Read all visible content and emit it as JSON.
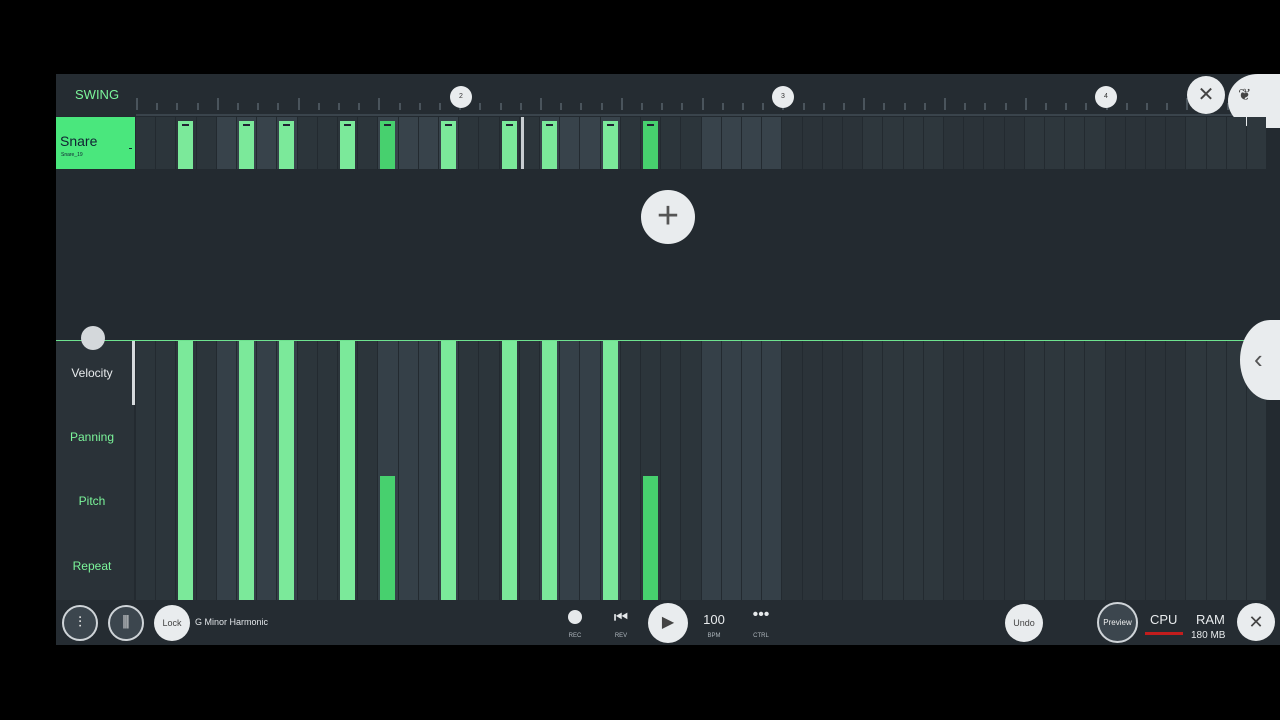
{
  "header": {
    "swing_label": "SWING",
    "bar_markers": [
      "2",
      "3",
      "4"
    ],
    "close_icon": "close-icon",
    "logo_icon": "fruit-logo-icon"
  },
  "channel": {
    "name": "Snare",
    "sample": "Snare_19",
    "steps_on": [
      2,
      5,
      7,
      10,
      12,
      15,
      18,
      20,
      23,
      25
    ],
    "steps_accent": [
      12,
      25
    ],
    "total_steps": 16
  },
  "add_button_icon": "plus-icon",
  "event_editor": {
    "labels": [
      "Velocity",
      "Panning",
      "Pitch",
      "Repeat"
    ],
    "active_label_color": "#e8ebed",
    "label_color": "#7bf59a",
    "velocity_values": [
      1.0,
      1.0,
      1.0,
      1.0,
      0.48,
      1.0,
      1.0,
      1.0,
      1.0,
      0.48
    ]
  },
  "side_tab_icon": "chevron-left-icon",
  "bottom": {
    "mixer_icon": "mixer-icon",
    "piano_settings_icon": "piano-settings-icon",
    "lock_label": "Lock",
    "scale": "G Minor Harmonic",
    "rec_label": "REC",
    "rev_label": "REV",
    "bpm_value": "100",
    "bpm_label": "BPM",
    "ctrl_label": "CTRL",
    "undo_label": "Undo",
    "preview_label": "Preview",
    "cpu_label": "CPU",
    "ram_label": "RAM",
    "ram_value": "180 MB"
  },
  "colors": {
    "accent_green": "#4ae77d",
    "step_green": "#7be99a",
    "background": "#232a30",
    "cpu_meter": "#c21d1d"
  }
}
